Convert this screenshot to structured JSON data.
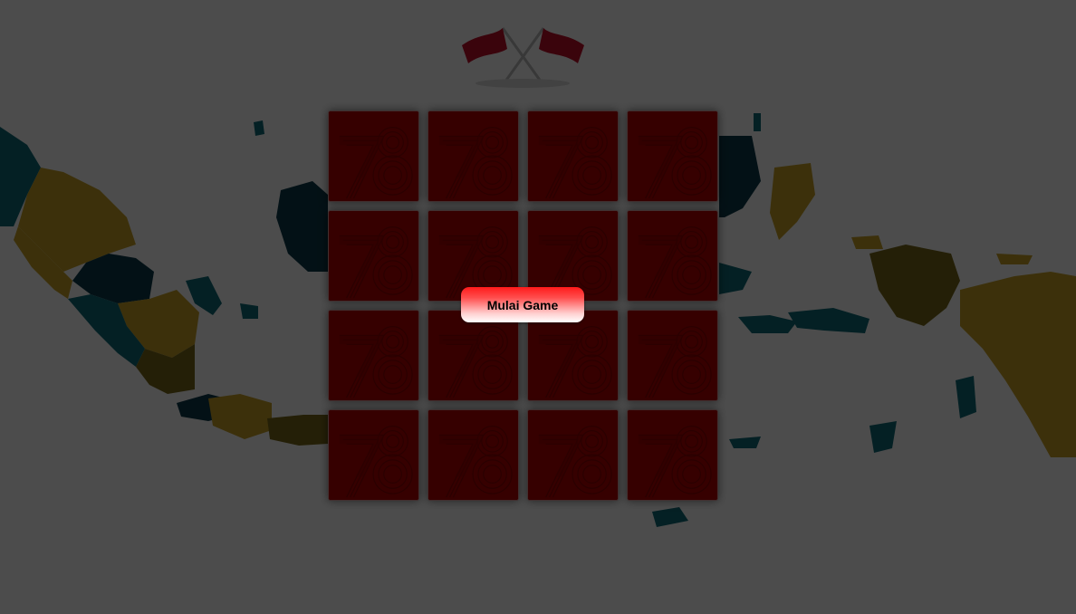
{
  "game": {
    "start_button_label": "Mulai Game",
    "card_count": 16,
    "card_back_emblem": "78-logo-icon",
    "background": "indonesia-map",
    "header_icon": "crossed-flags-icon"
  },
  "colors": {
    "card_back": "#b40000",
    "button_top": "#ff1a1a",
    "button_bottom": "#ffffff",
    "map_teal": "#0f6b78",
    "map_gold": "#c9a227",
    "map_dark_teal": "#0c3a4a"
  }
}
